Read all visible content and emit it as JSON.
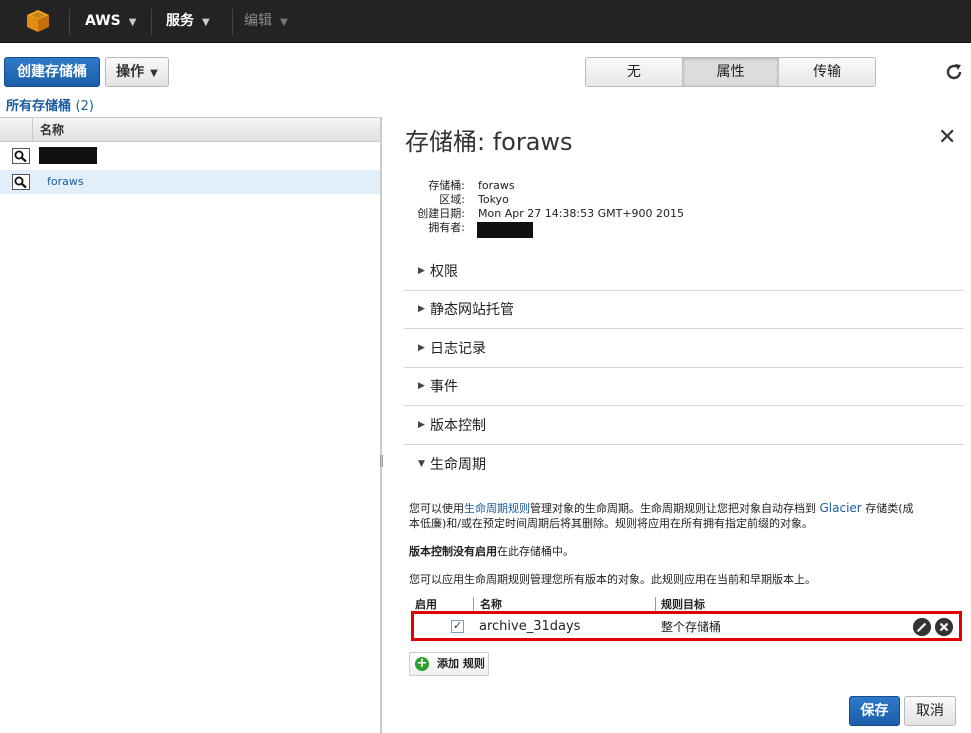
{
  "topnav": {
    "logo_icon": "aws-cube-icon",
    "aws_label": "AWS",
    "services_label": "服务",
    "edit_label": "编辑"
  },
  "toolbar": {
    "create_bucket_label": "创建存储桶",
    "actions_label": "操作",
    "segments": [
      "无",
      "属性",
      "传输"
    ],
    "active_segment": "属性"
  },
  "buckets": {
    "heading": "所有存储桶",
    "count": "(2)",
    "column_name": "名称",
    "items": [
      {
        "name": "",
        "redacted": true
      },
      {
        "name": "foraws",
        "selected": true
      }
    ]
  },
  "detail": {
    "title": "存储桶: foraws",
    "meta": {
      "bucket_key": "存储桶:",
      "bucket_val": "foraws",
      "region_key": "区域:",
      "region_val": "Tokyo",
      "created_key": "创建日期:",
      "created_val": "Mon Apr 27 14:38:53 GMT+900 2015",
      "owner_key": "拥有者:"
    },
    "sections": [
      "权限",
      "静态网站托管",
      "日志记录",
      "事件",
      "版本控制",
      "生命周期"
    ],
    "lifecycle": {
      "intro_1": "您可以使用",
      "intro_link": "生命周期规则",
      "intro_2": "管理对象的生命周期。生命周期规则让您把对象自动存档到 ",
      "glacier": "Glacier",
      "intro_3": " 存储类(成",
      "intro_line2": "本低廉)和/或在预定时间周期后将其删除。规则将应用在所有拥有指定前缀的对象。",
      "versioning_bold": "版本控制没有启用",
      "versioning_rest": "在此存储桶中。",
      "apply_note": "您可以应用生命周期规则管理您所有版本的对象。此规则应用在当前和早期版本上。",
      "col_enabled": "启用",
      "col_name": "名称",
      "col_target": "规则目标",
      "rules": [
        {
          "enabled": true,
          "name": "archive_31days",
          "target": "整个存储桶"
        }
      ],
      "add_rule_label": "添加 规则"
    },
    "save_label": "保存",
    "cancel_label": "取消"
  }
}
